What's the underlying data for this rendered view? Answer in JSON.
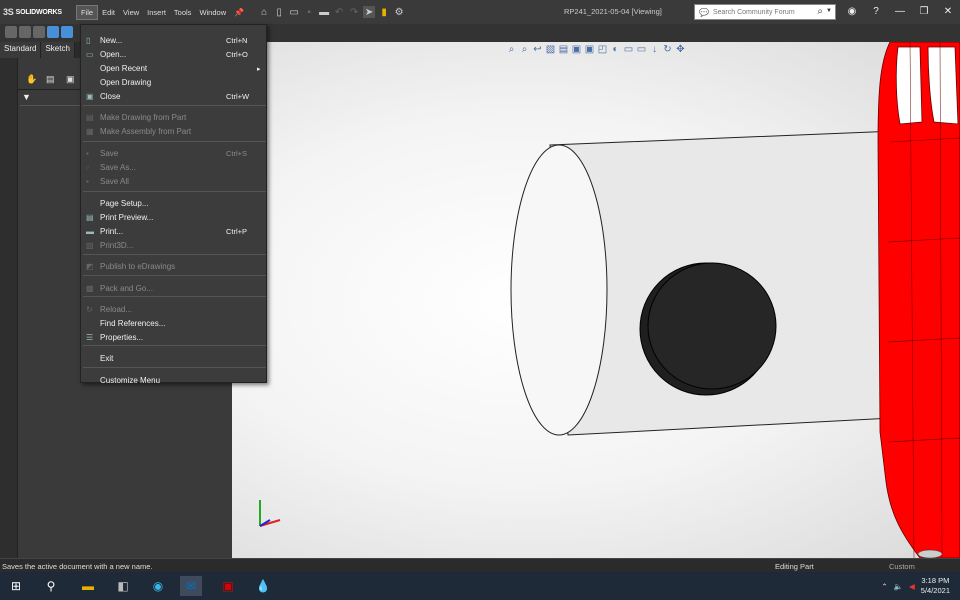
{
  "app": {
    "name": "SOLIDWORKS",
    "ds": "3S"
  },
  "menubar": [
    "File",
    "Edit",
    "View",
    "Insert",
    "Tools",
    "Window"
  ],
  "document_title": "RP241_2021-05-04 [Viewing]",
  "search": {
    "placeholder": "Search Community Forum"
  },
  "tabs": [
    "Standard",
    "Sketch"
  ],
  "file_menu": [
    {
      "label": "New...",
      "shortcut": "Ctrl+N",
      "icon": "new-doc-icon",
      "enabled": true
    },
    {
      "label": "Open...",
      "shortcut": "Ctrl+O",
      "icon": "open-folder-icon",
      "enabled": true
    },
    {
      "label": "Open Recent",
      "shortcut": "",
      "icon": "",
      "enabled": true,
      "submenu": true
    },
    {
      "label": "Open Drawing",
      "shortcut": "",
      "icon": "",
      "enabled": true
    },
    {
      "label": "Close",
      "shortcut": "Ctrl+W",
      "icon": "close-doc-icon",
      "enabled": true
    },
    {
      "label": "Make Drawing from Part",
      "shortcut": "",
      "icon": "drawing-icon",
      "enabled": false
    },
    {
      "label": "Make Assembly from Part",
      "shortcut": "",
      "icon": "assembly-icon",
      "enabled": false
    },
    {
      "label": "Save",
      "shortcut": "Ctrl+S",
      "icon": "save-icon",
      "enabled": false
    },
    {
      "label": "Save As...",
      "shortcut": "",
      "icon": "save-as-icon",
      "enabled": false
    },
    {
      "label": "Save All",
      "shortcut": "",
      "icon": "save-all-icon",
      "enabled": false
    },
    {
      "label": "Page Setup...",
      "shortcut": "",
      "icon": "",
      "enabled": true
    },
    {
      "label": "Print Preview...",
      "shortcut": "",
      "icon": "print-preview-icon",
      "enabled": true
    },
    {
      "label": "Print...",
      "shortcut": "Ctrl+P",
      "icon": "print-icon",
      "enabled": true
    },
    {
      "label": "Print3D...",
      "shortcut": "",
      "icon": "print3d-icon",
      "enabled": false
    },
    {
      "label": "Publish to eDrawings",
      "shortcut": "",
      "icon": "edrawings-icon",
      "enabled": false
    },
    {
      "label": "Pack and Go...",
      "shortcut": "",
      "icon": "pack-go-icon",
      "enabled": false
    },
    {
      "label": "Reload...",
      "shortcut": "",
      "icon": "reload-icon",
      "enabled": false
    },
    {
      "label": "Find References...",
      "shortcut": "",
      "icon": "",
      "enabled": true
    },
    {
      "label": "Properties...",
      "shortcut": "",
      "icon": "properties-icon",
      "enabled": true
    },
    {
      "label": "Exit",
      "shortcut": "",
      "icon": "",
      "enabled": true
    },
    {
      "label": "Customize Menu",
      "shortcut": "",
      "icon": "",
      "enabled": true
    }
  ],
  "status": {
    "message": "Saves the active document with a new name.",
    "mode": "Editing Part",
    "units": "Custom"
  },
  "taskbar": {
    "time": "3:18 PM",
    "date": "5/4/2021"
  },
  "colors": {
    "part_red": "#ff0000",
    "cylinder": "#e6e6e6",
    "boss": "#1a1a1a"
  }
}
